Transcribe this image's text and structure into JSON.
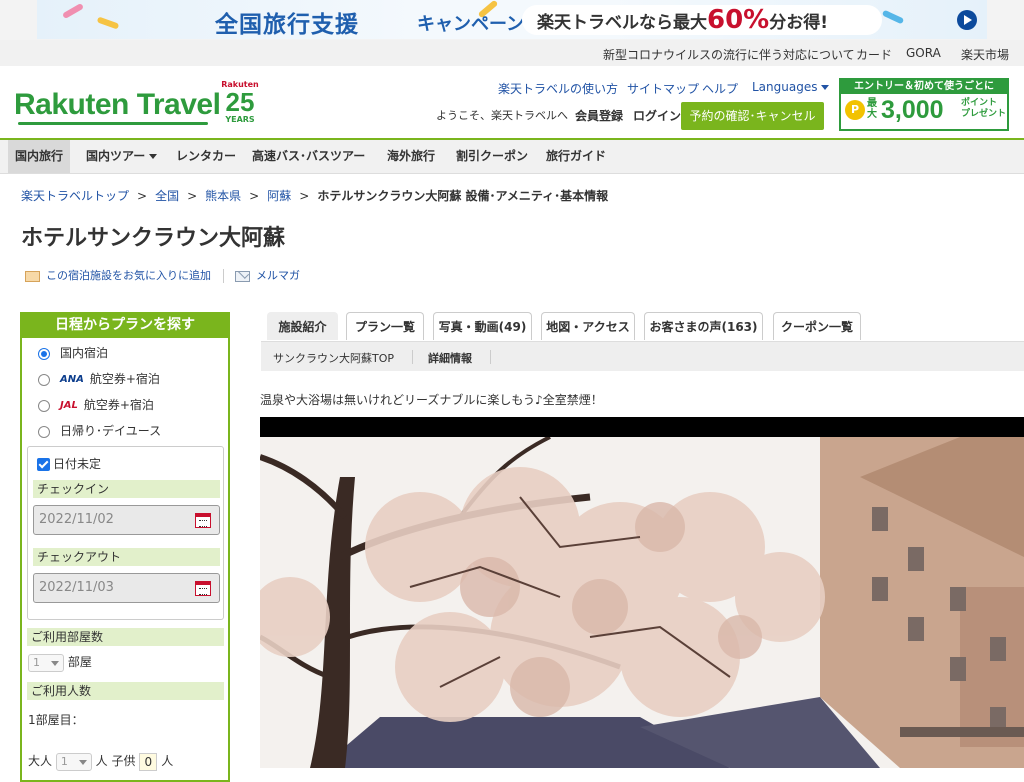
{
  "banner": {
    "title": "全国旅行支援",
    "title_suffix": "キャンペーン",
    "promo_prefix": "楽天トラベルなら最大",
    "promo_big": "60%",
    "promo_suffix": "分お得!"
  },
  "toplinks": [
    "新型コロナウイルスの流行に伴う対応について",
    "カード",
    "GORA",
    "楽天市場"
  ],
  "header": {
    "logo": "Rakuten Travel",
    "anniv_small": "Rakuten",
    "anniv_num": "25",
    "anniv_years": "YEARS",
    "links": [
      "楽天トラベルの使い方",
      "サイトマップ",
      "ヘルプ",
      "Languages"
    ],
    "welcome": "ようこそ、楽天トラベルへ",
    "register": "会員登録",
    "login": "ログイン",
    "reserve_button": "予約の確認･キャンセル",
    "promo": {
      "top": "エントリー＆初めて使うごとに",
      "coin": "P",
      "max": "最大",
      "amount": "3,000",
      "points": "ポイント",
      "present": "プレゼント"
    }
  },
  "gnav": [
    "国内旅行",
    "国内ツアー",
    "レンタカー",
    "高速バス･バスツアー",
    "海外旅行",
    "割引クーポン",
    "旅行ガイド"
  ],
  "breadcrumb": {
    "items": [
      "楽天トラベルトップ",
      "全国",
      "熊本県",
      "阿蘇"
    ],
    "current": "ホテルサンクラウン大阿蘇 設備･アメニティ･基本情報",
    "sep": ">"
  },
  "hotel": {
    "name": "ホテルサンクラウン大阿蘇",
    "favorite": "この宿泊施設をお気に入りに追加",
    "mailmag": "メルマガ",
    "catch_copy": "温泉や大浴場は無いけれどリーズナブルに楽しもう♪全室禁煙！"
  },
  "search": {
    "heading": "日程からプランを探す",
    "options": [
      {
        "label": "国内宿泊",
        "airline": "",
        "selected": true
      },
      {
        "label": "航空券+宿泊",
        "airline": "ANA",
        "selected": false
      },
      {
        "label": "航空券+宿泊",
        "airline": "JAL",
        "selected": false
      },
      {
        "label": "日帰り･デイユース",
        "airline": "",
        "selected": false
      }
    ],
    "undecided_label": "日付未定",
    "undecided_checked": true,
    "checkin_label": "チェックイン",
    "checkin_value": "2022/11/02",
    "checkout_label": "チェックアウト",
    "checkout_value": "2022/11/03",
    "rooms_label": "ご利用部屋数",
    "rooms_value": "1",
    "rooms_unit": "部屋",
    "guests_label": "ご利用人数",
    "room1_label": "1部屋目：",
    "adult_label": "大人",
    "adult_value": "1",
    "person_unit": "人",
    "child_label": "子供",
    "child_value": "0"
  },
  "tabs": [
    "施設紹介",
    "プラン一覧",
    "写真・動画(49)",
    "地図・アクセス",
    "お客さまの声(163)",
    "クーポン一覧"
  ],
  "subnav": [
    "サンクラウン大阿蘇TOP",
    "詳細情報"
  ],
  "colors": {
    "brand_green": "#7ab51d",
    "logo_green": "#2e9b3d",
    "link_blue": "#2153a5",
    "accent_red": "#c8102e"
  }
}
